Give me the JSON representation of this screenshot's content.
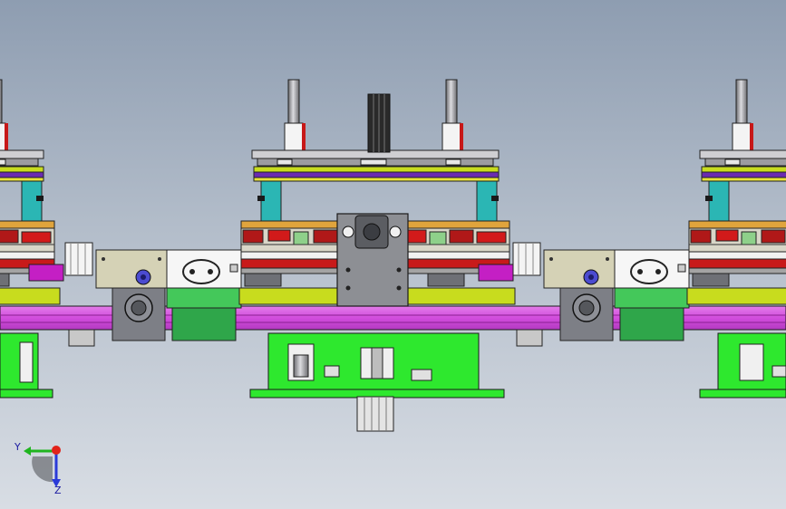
{
  "viewport": {
    "background_top": "#8e9db1",
    "background_bottom": "#d8dde4"
  },
  "model": {
    "colors": {
      "rail_magenta": "#d64fe0",
      "base_green": "#2ee82e",
      "plate_yellow": "#c8dc1e",
      "plate_orange": "#e0a43c",
      "block_red": "#d21a1a",
      "block_cyan": "#2bb6b4",
      "bar_purple": "#6a2bb0",
      "pad_magenta": "#c41fc4",
      "cylinder_gray": "#a8a8ac",
      "motor_gray": "#7d7f86",
      "panel_tan": "#d5d2b6",
      "accent_blue": "#4b4bd0"
    }
  },
  "triad": {
    "x_label": "",
    "y_label": "Y",
    "z_label": "Z",
    "icons": [
      "y-axis-arrow-icon",
      "z-axis-arrow-icon",
      "origin-sphere-icon"
    ]
  }
}
